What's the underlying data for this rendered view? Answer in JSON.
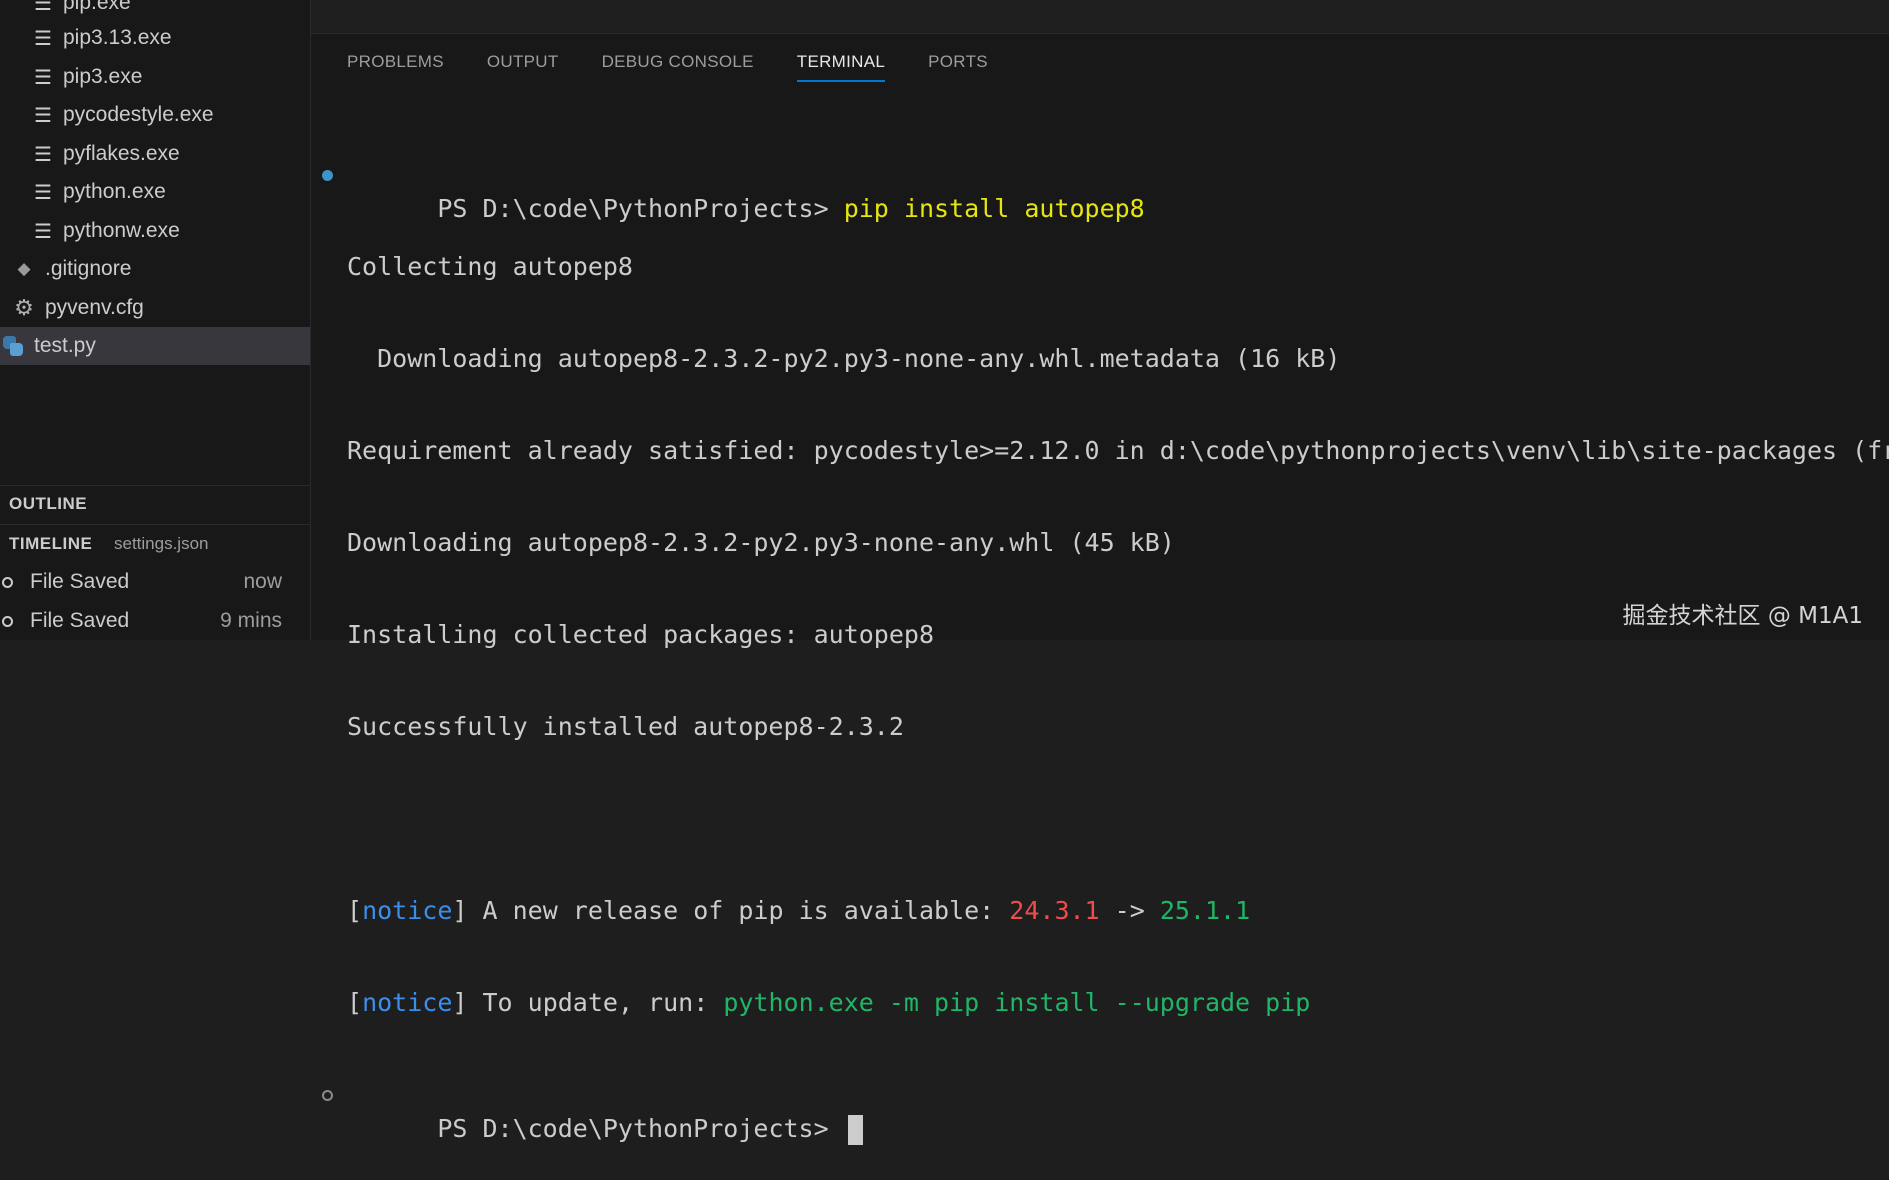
{
  "explorer": {
    "items": [
      {
        "label": "pip.exe",
        "icon": "lines-icon"
      },
      {
        "label": "pip3.13.exe",
        "icon": "lines-icon"
      },
      {
        "label": "pip3.exe",
        "icon": "lines-icon"
      },
      {
        "label": "pycodestyle.exe",
        "icon": "lines-icon"
      },
      {
        "label": "pyflakes.exe",
        "icon": "lines-icon"
      },
      {
        "label": "python.exe",
        "icon": "lines-icon"
      },
      {
        "label": "pythonw.exe",
        "icon": "lines-icon"
      },
      {
        "label": ".gitignore",
        "icon": "git-icon"
      },
      {
        "label": "pyvenv.cfg",
        "icon": "gear-icon"
      },
      {
        "label": "test.py",
        "icon": "python-icon",
        "selected": true
      }
    ]
  },
  "outline": {
    "title": "OUTLINE"
  },
  "timeline": {
    "title": "TIMELINE",
    "file": "settings.json",
    "entries": [
      {
        "label": "File Saved",
        "time": "now"
      },
      {
        "label": "File Saved",
        "time": "9 mins"
      }
    ]
  },
  "panel": {
    "tabs": [
      {
        "label": "PROBLEMS"
      },
      {
        "label": "OUTPUT"
      },
      {
        "label": "DEBUG CONSOLE"
      },
      {
        "label": "TERMINAL",
        "active": true
      },
      {
        "label": "PORTS"
      }
    ]
  },
  "terminal": {
    "prompt": "PS D:\\code\\PythonProjects> ",
    "command": "pip install autopep8",
    "lines": [
      "Collecting autopep8",
      "  Downloading autopep8-2.3.2-py2.py3-none-any.whl.metadata (16 kB)",
      "Requirement already satisfied: pycodestyle>=2.12.0 in d:\\code\\pythonprojects\\venv\\lib\\site-packages (fr",
      "Downloading autopep8-2.3.2-py2.py3-none-any.whl (45 kB)",
      "Installing collected packages: autopep8",
      "Successfully installed autopep8-2.3.2"
    ],
    "notice1": {
      "open": "[",
      "tag": "notice",
      "close": "]",
      "text": " A new release of pip is available: ",
      "old_version": "24.3.1",
      "arrow": " -> ",
      "new_version": "25.1.1"
    },
    "notice2": {
      "open": "[",
      "tag": "notice",
      "close": "]",
      "text": " To update, run: ",
      "command": "python.exe -m pip install --upgrade pip"
    },
    "final_prompt": "PS D:\\code\\PythonProjects> "
  },
  "watermark": "掘金技术社区 @ M1A1",
  "colors": {
    "accent": "#0078d4",
    "command": "#e5e510",
    "notice": "#3b8eea",
    "old_version": "#f14c4c",
    "new_version": "#20b567"
  }
}
